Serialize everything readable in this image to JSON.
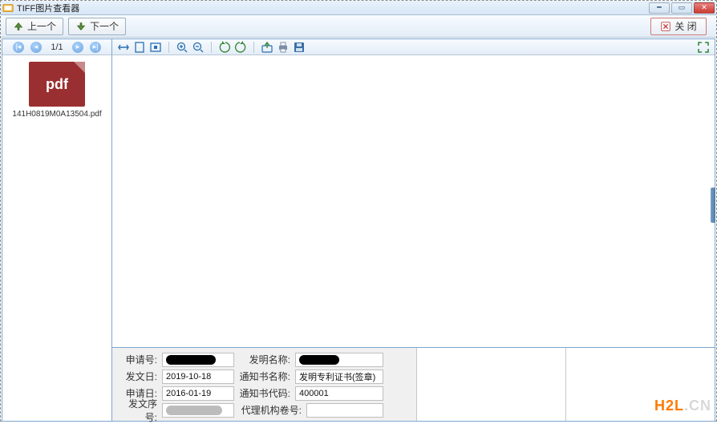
{
  "titlebar": {
    "title": "TIFF图片查看器"
  },
  "topbar": {
    "prev_label": "上一个",
    "next_label": "下一个",
    "close_label": "关 闭"
  },
  "nav": {
    "page_text": "1/1"
  },
  "thumb": {
    "badge": "pdf",
    "filename": "141H0819M0A13504.pdf"
  },
  "form": {
    "row1": {
      "label_a": "申请号:",
      "value_a_redacted": true,
      "label_b": "发明名称:",
      "value_b_redacted": true
    },
    "row2": {
      "label_a": "发文日:",
      "value_a": "2019-10-18",
      "label_b": "通知书名称:",
      "value_b": "发明专利证书(签章)"
    },
    "row3": {
      "label_a": "申请日:",
      "value_a": "2016-01-19",
      "label_b": "通知书代码:",
      "value_b": "400001"
    },
    "row4": {
      "label_a": "发文序号:",
      "value_a_redacted": true,
      "label_b": "代理机构卷号:",
      "value_b": ""
    }
  },
  "watermark": {
    "a": "H2L",
    "b": ".CN"
  }
}
